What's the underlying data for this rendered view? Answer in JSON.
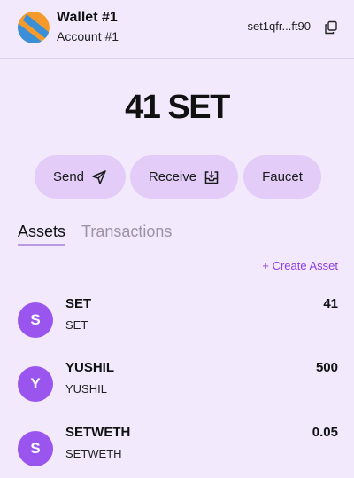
{
  "header": {
    "wallet_name": "Wallet #1",
    "account_name": "Account #1",
    "address": "set1qfr...ft90",
    "avatar_colors": [
      "#f39a2a",
      "#3b8fd6"
    ]
  },
  "balance": "41 SET",
  "actions": {
    "send": "Send",
    "receive": "Receive",
    "faucet": "Faucet"
  },
  "tabs": [
    {
      "label": "Assets",
      "active": true
    },
    {
      "label": "Transactions",
      "active": false
    }
  ],
  "create_asset_label": "+ Create Asset",
  "assets": [
    {
      "letter": "S",
      "name": "SET",
      "sub": "SET",
      "amount": "41"
    },
    {
      "letter": "Y",
      "name": "YUSHIL",
      "sub": "YUSHIL",
      "amount": "500"
    },
    {
      "letter": "S",
      "name": "SETWETH",
      "sub": "SETWETH",
      "amount": "0.05"
    }
  ],
  "colors": {
    "background": "#f3e9fd",
    "button": "#e3cdf8",
    "accent": "#8c3ee0",
    "asset_icon": "#9a55ee"
  },
  "icons": {
    "copy": "copy-icon",
    "send": "paper-plane-icon",
    "receive": "download-tray-icon"
  }
}
